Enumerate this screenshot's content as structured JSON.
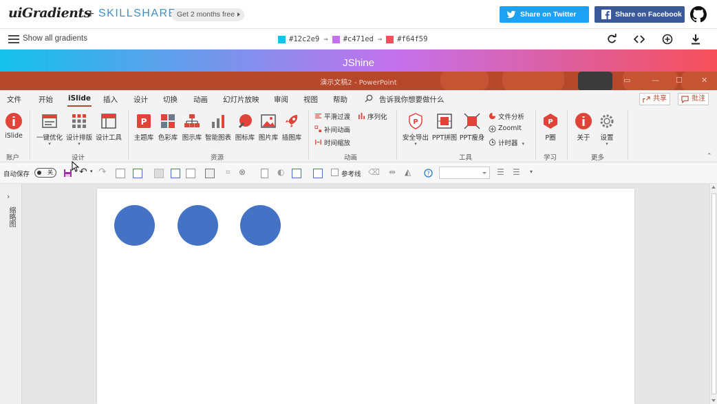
{
  "site": {
    "logo": "uiGradients",
    "plus": "+",
    "partner": "SKILLSHARE",
    "promo": "Get 2 months free",
    "twitter_label": "Share on Twitter",
    "facebook_label": "Share on Facebook"
  },
  "gradient_bar": {
    "show_all_label": "Show all gradients",
    "colors": [
      "#12c2e9",
      "#c471ed",
      "#f64f59"
    ],
    "color_labels": [
      "#12c2e9",
      "#c471ed",
      "#f64f59"
    ],
    "arrow": "→",
    "tools": [
      "rotate-icon",
      "code-icon",
      "add-icon",
      "download-icon"
    ]
  },
  "banner": {
    "name": "JShine"
  },
  "ppt": {
    "title": "演示文稿2 - PowerPoint",
    "menu": [
      "文件",
      "开始",
      "iSlide",
      "插入",
      "设计",
      "切换",
      "动画",
      "幻灯片放映",
      "审阅",
      "视图",
      "帮助"
    ],
    "tell_me": "告诉我你想要做什么",
    "share": "共享",
    "comment": "批注",
    "ribbon": {
      "account": {
        "btn": "iSlide",
        "label": "账户"
      },
      "design": {
        "btns": [
          "一键优化",
          "设计排版",
          "设计工具"
        ],
        "label": "设计"
      },
      "resources": {
        "btns": [
          "主题库",
          "色彩库",
          "图示库",
          "智能图表",
          "图标库",
          "图片库",
          "插图库"
        ],
        "label": "资源"
      },
      "animation": {
        "items": [
          "平滑过渡",
          "序列化",
          "补间动画",
          "时间缩放"
        ],
        "label": "动画"
      },
      "tools": {
        "btns": [
          "安全导出",
          "PPT拼图",
          "PPT瘦身"
        ],
        "items": [
          "文件分析",
          "ZoomIt",
          "计时器"
        ],
        "label": "工具"
      },
      "learn": {
        "btn": "P圈",
        "label": "学习"
      },
      "more": {
        "btns": [
          "关于",
          "设置"
        ],
        "label": "更多"
      }
    },
    "quick": {
      "autosave": "自动保存",
      "toggle": "关",
      "guides": "参考线"
    },
    "side_label": "缩略图"
  }
}
